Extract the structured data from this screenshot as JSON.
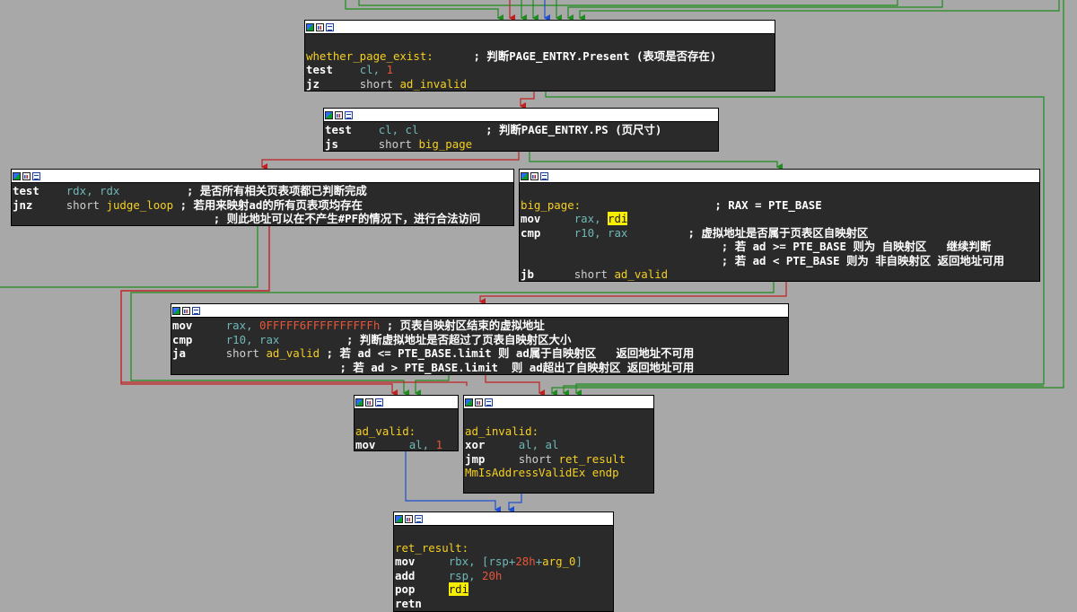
{
  "colors": {
    "background": "#a8a8a8",
    "node_body": "#2a2a2a",
    "edge_true": "#1e8c1e",
    "edge_false": "#c02020",
    "edge_jump": "#2050d0"
  },
  "icons": [
    "color-icon",
    "graph-icon",
    "text-icon"
  ],
  "nodes": {
    "whether_page_exist": {
      "l0_label": "whether_page_exist:",
      "l0_comment": "; 判断PAGE_ENTRY.Present (表项是否存在)",
      "l1_mn": "test",
      "l1_op": "cl,",
      "l1_num": "1",
      "l2_mn": "jz",
      "l2_kw": "short",
      "l2_ref": "ad_invalid"
    },
    "test_ps": {
      "l0_mn": "test",
      "l0_op": "cl, cl",
      "l0_comment": "; 判断PAGE_ENTRY.PS (页尺寸)",
      "l1_mn": "js",
      "l1_kw": "short",
      "l1_ref": "big_page"
    },
    "judge_loop_block": {
      "l0_mn": "test",
      "l0_op": "rdx, rdx",
      "l0_comment": "; 是否所有相关页表项都已判断完成",
      "l1_mn": "jnz",
      "l1_kw": "short",
      "l1_ref": "judge_loop",
      "l1_comment": "; 若用来映射ad的所有页表项均存在",
      "l2_comment": "; 则此地址可以在不产生#PF的情况下，进行合法访问"
    },
    "big_page": {
      "l0_label": "big_page:",
      "l0_comment": "; RAX = PTE_BASE",
      "l1_mn": "mov",
      "l1_op": "rax,",
      "l1_hl": "rdi",
      "l2_mn": "cmp",
      "l2_op": "r10, rax",
      "l2_comment": "; 虚拟地址是否属于页表区自映射区",
      "l3_comment": "; 若 ad >= PTE_BASE 则为 自映射区   继续判断",
      "l4_comment": "; 若 ad < PTE_BASE 则为 非自映射区 返回地址可用",
      "l5_mn": "jb",
      "l5_kw": "short",
      "l5_ref": "ad_valid"
    },
    "limit_check": {
      "l0_mn": "mov",
      "l0_op": "rax,",
      "l0_num": "0FFFFF6FFFFFFFFFFh",
      "l0_comment": "; 页表自映射区结束的虚拟地址",
      "l1_mn": "cmp",
      "l1_op": "r10, rax",
      "l1_comment": "; 判断虚拟地址是否超过了页表自映射区大小",
      "l2_mn": "ja",
      "l2_kw": "short",
      "l2_ref": "ad_valid",
      "l2_comment": "; 若 ad <= PTE_BASE.limit 则 ad属于自映射区   返回地址不可用",
      "l3_comment": "; 若 ad > PTE_BASE.limit  则 ad超出了自映射区 返回地址可用"
    },
    "ad_valid": {
      "l0_label": "ad_valid:",
      "l1_mn": "mov",
      "l1_op": "al,",
      "l1_num": "1"
    },
    "ad_invalid": {
      "l0_label": "ad_invalid:",
      "l1_mn": "xor",
      "l1_op": "al, al",
      "l2_mn": "jmp",
      "l2_kw": "short",
      "l2_ref": "ret_result",
      "l3_endp": "MmIsAddressValidEx endp"
    },
    "ret_result": {
      "l0_label": "ret_result:",
      "l1_mn": "mov",
      "l1_op_a": "rbx, [rsp+",
      "l1_num": "28h",
      "l1_op_b": "+",
      "l1_ref": "arg_0",
      "l1_op_c": "]",
      "l2_mn": "add",
      "l2_op": "rsp,",
      "l2_num": "20h",
      "l3_mn": "pop",
      "l3_hl": "rdi",
      "l4_mn": "retn"
    }
  }
}
